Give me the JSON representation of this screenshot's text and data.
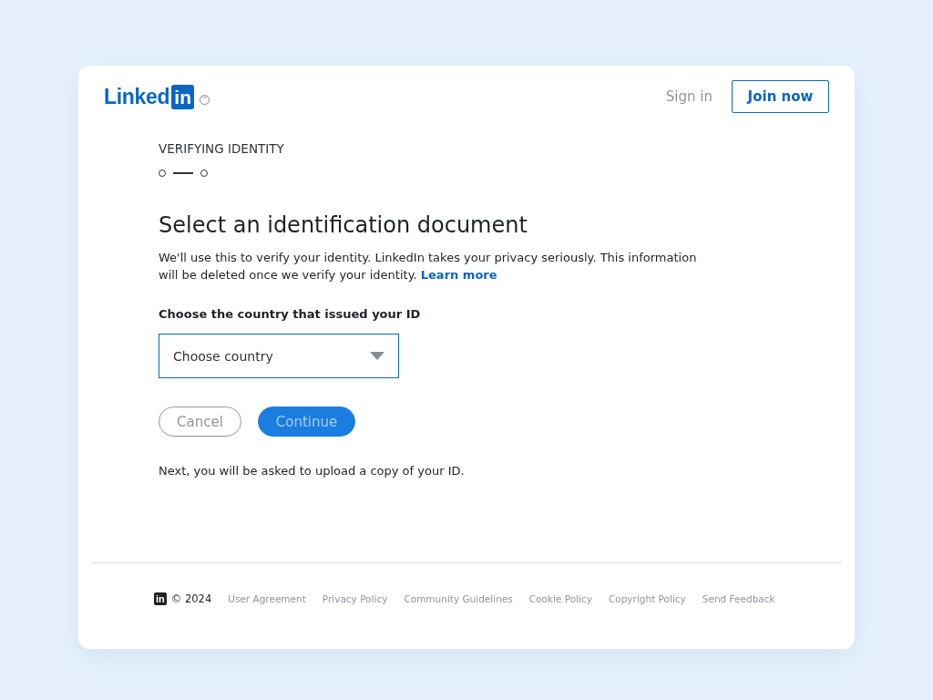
{
  "header": {
    "logo_word": "Linked",
    "logo_box": "in",
    "trademark": "™",
    "sign_in": "Sign in",
    "join_now": "Join now"
  },
  "step_label": "VERIFYING IDENTITY",
  "title": "Select an identification document",
  "description": "We'll use this to verify your identity. LinkedIn takes your privacy seriously. This information will be deleted once we verify your identity.",
  "learn_more": "Learn more",
  "country_label": "Choose the country that issued your ID",
  "country_select": {
    "placeholder": "Choose country"
  },
  "buttons": [
    {
      "kind": "secondary",
      "label": "Cancel",
      "disabled": false
    },
    {
      "kind": "primary",
      "label": "Continue",
      "disabled": true
    }
  ],
  "next_note": "Next, you will be asked to upload a copy of your ID.",
  "footer": {
    "logo_box": "in",
    "copyright": "© 2024",
    "links": [
      "User Agreement",
      "Privacy Policy",
      "Community Guidelines",
      "Cookie Policy",
      "Copyright Policy",
      "Send Feedback"
    ]
  }
}
